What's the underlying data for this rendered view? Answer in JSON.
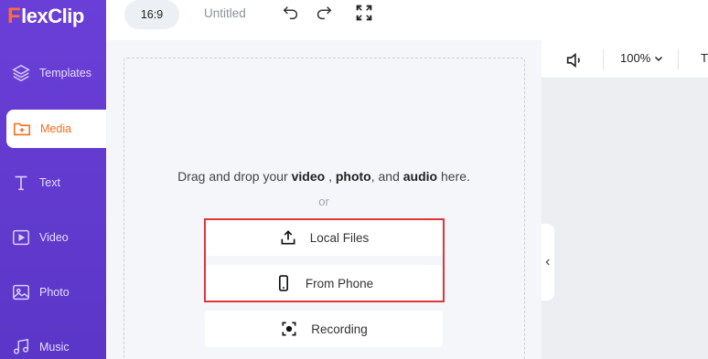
{
  "app": {
    "logo_letter": "F",
    "logo_rest": "lexClip"
  },
  "sidebar": {
    "items": [
      {
        "label": "Templates",
        "icon": "layers-icon",
        "active": false
      },
      {
        "label": "Media",
        "icon": "media-folder-icon",
        "active": true
      },
      {
        "label": "Text",
        "icon": "text-icon",
        "active": false
      },
      {
        "label": "Video",
        "icon": "video-icon",
        "active": false
      },
      {
        "label": "Photo",
        "icon": "photo-icon",
        "active": false
      },
      {
        "label": "Music",
        "icon": "music-icon",
        "active": false
      }
    ]
  },
  "topbar": {
    "aspect_ratio": "16:9",
    "project_title": "Untitled"
  },
  "upload": {
    "drag_prefix": "Drag and drop your",
    "drag_video": "video",
    "drag_sep1": ",",
    "drag_photo": "photo",
    "drag_sep2": ", and",
    "drag_audio": "audio",
    "drag_suffix": "here.",
    "or": "or",
    "local_files": "Local Files",
    "from_phone": "From Phone",
    "recording": "Recording"
  },
  "preview": {
    "zoom": "100%",
    "edge_text": "T"
  },
  "colors": {
    "sidebar": "#5f38cc",
    "accent": "#ff6b1a",
    "highlight": "#e0353b"
  }
}
